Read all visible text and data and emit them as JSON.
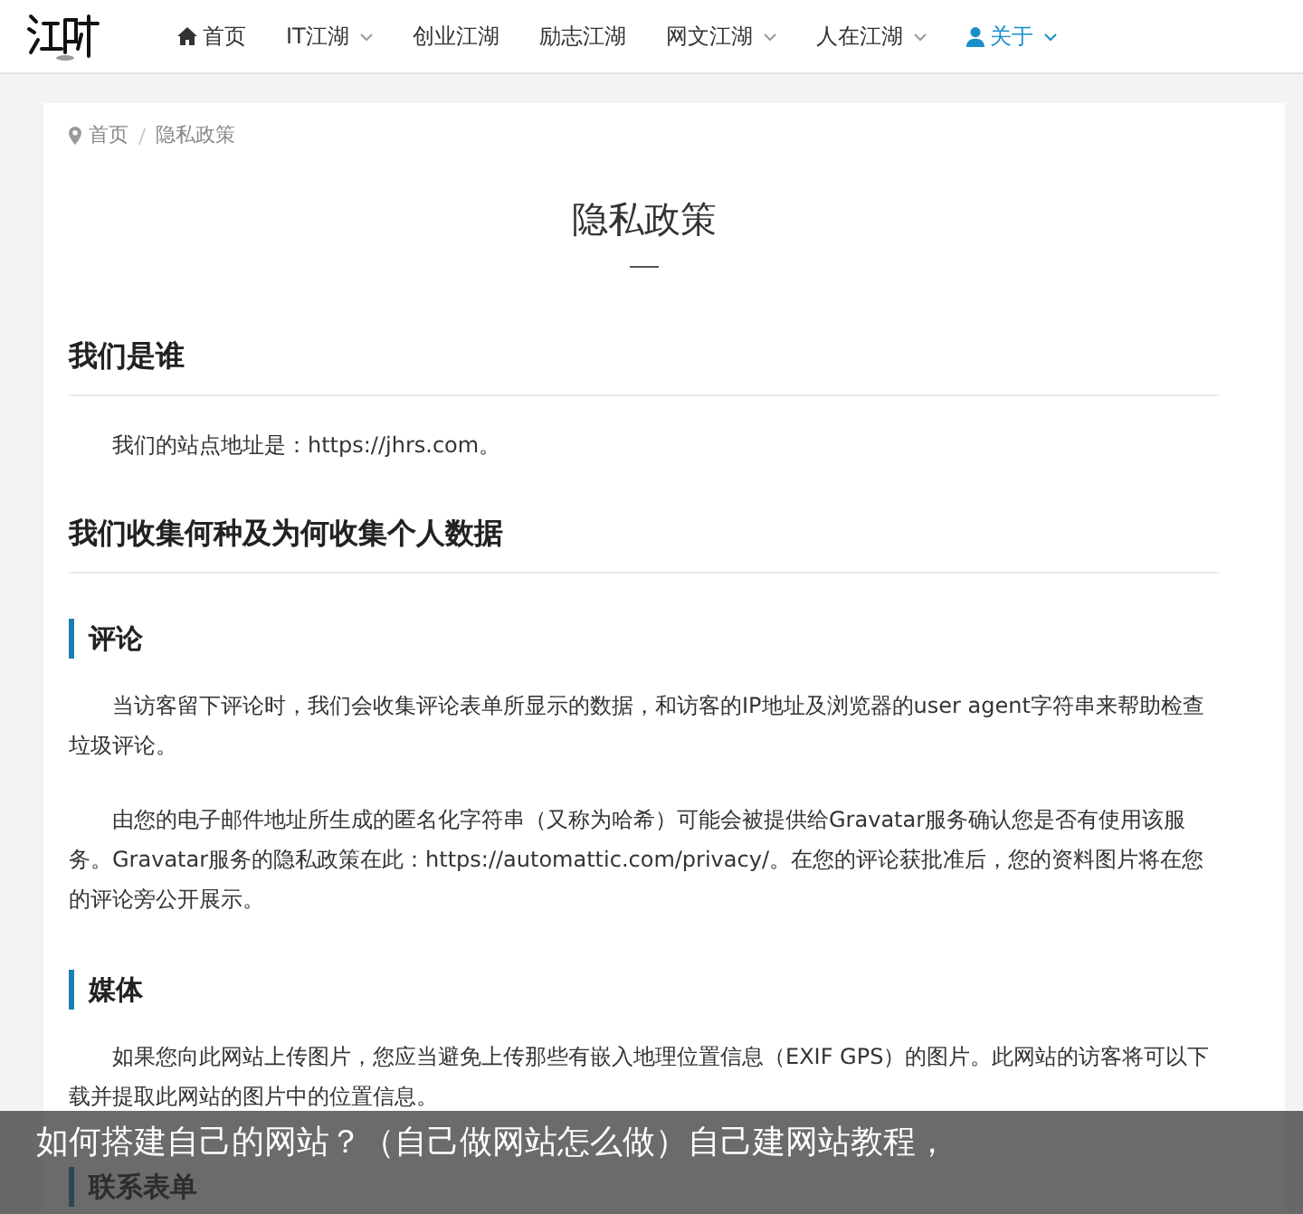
{
  "header": {
    "nav": [
      {
        "label": "首页",
        "kind": "home",
        "dropdown": false,
        "selected": false
      },
      {
        "label": "IT江湖",
        "kind": "plain",
        "dropdown": true,
        "selected": false
      },
      {
        "label": "创业江湖",
        "kind": "plain",
        "dropdown": false,
        "selected": false
      },
      {
        "label": "励志江湖",
        "kind": "plain",
        "dropdown": false,
        "selected": false
      },
      {
        "label": "网文江湖",
        "kind": "plain",
        "dropdown": true,
        "selected": false
      },
      {
        "label": "人在江湖",
        "kind": "plain",
        "dropdown": true,
        "selected": false
      },
      {
        "label": "关于",
        "kind": "user",
        "dropdown": true,
        "selected": true
      }
    ]
  },
  "breadcrumb": [
    "首页",
    "隐私政策"
  ],
  "title": "隐私政策",
  "sections": [
    {
      "kind": "h2",
      "text": "我们是谁"
    },
    {
      "kind": "p",
      "text": "我们的站点地址是：https://jhrs.com。"
    },
    {
      "kind": "h2",
      "text": "我们收集何种及为何收集个人数据"
    },
    {
      "kind": "h3",
      "text": "评论"
    },
    {
      "kind": "p",
      "text": "当访客留下评论时，我们会收集评论表单所显示的数据，和访客的IP地址及浏览器的user agent字符串来帮助检查垃圾评论。"
    },
    {
      "kind": "p",
      "text": "由您的电子邮件地址所生成的匿名化字符串（又称为哈希）可能会被提供给Gravatar服务确认您是否有使用该服务。Gravatar服务的隐私政策在此：https://automattic.com/privacy/。在您的评论获批准后，您的资料图片将在您的评论旁公开展示。"
    },
    {
      "kind": "h3",
      "text": "媒体"
    },
    {
      "kind": "p",
      "text": "如果您向此网站上传图片，您应当避免上传那些有嵌入地理位置信息（EXIF GPS）的图片。此网站的访客将可以下载并提取此网站的图片中的位置信息。"
    },
    {
      "kind": "h3",
      "text": "联系表单"
    }
  ],
  "caption": "如何搭建自己的网站？（自己做网站怎么做）自己建网站教程，"
}
